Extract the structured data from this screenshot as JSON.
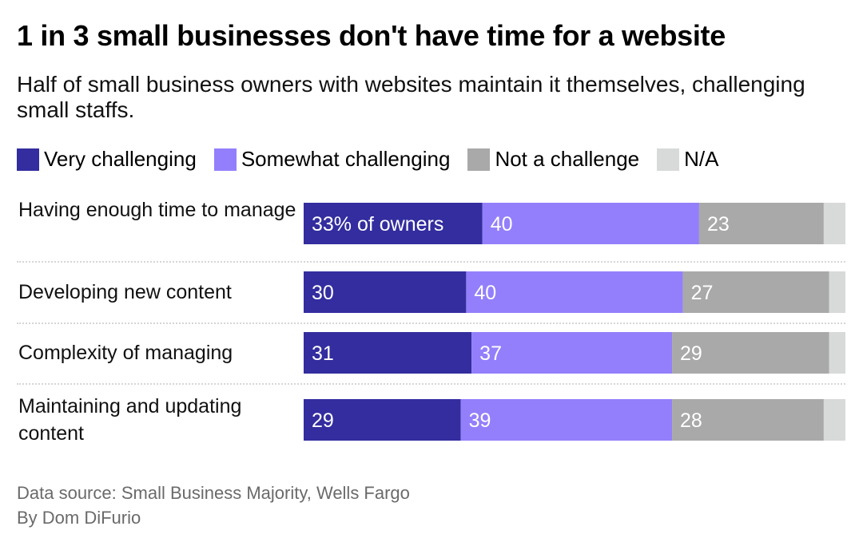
{
  "title": "1 in 3 small businesses don't have time for a website",
  "subtitle": "Half of small business owners with websites maintain it themselves, challenging small staffs.",
  "footer": {
    "source": "Data source: Small Business Majority, Wells Fargo",
    "byline": "By Dom DiFurio"
  },
  "chart_data": {
    "type": "bar",
    "orientation": "horizontal",
    "stacked": true,
    "title": "1 in 3 small businesses don't have time for a website",
    "subtitle": "Half of small business owners with websites maintain it themselves, challenging small staffs.",
    "xlabel": "",
    "ylabel": "",
    "xlim": [
      0,
      100
    ],
    "grid": false,
    "legend_position": "top-left",
    "categories": [
      "Having enough time to manage",
      "Developing new content",
      "Complexity of managing",
      "Maintaining and updating content"
    ],
    "series": [
      {
        "name": "Very challenging",
        "color": "#332d9f",
        "values": [
          33,
          30,
          31,
          29
        ],
        "labels": [
          "33% of owners",
          "30",
          "31",
          "29"
        ]
      },
      {
        "name": "Somewhat challenging",
        "color": "#937ffb",
        "values": [
          40,
          40,
          37,
          39
        ],
        "labels": [
          "40",
          "40",
          "37",
          "39"
        ]
      },
      {
        "name": "Not a challenge",
        "color": "#a9a9a9",
        "values": [
          23,
          27,
          29,
          28
        ],
        "labels": [
          "23",
          "27",
          "29",
          "28"
        ]
      },
      {
        "name": "N/A",
        "color": "#d8d9d9",
        "values": [
          4,
          3,
          3,
          4
        ],
        "labels": [
          "",
          "",
          "",
          ""
        ]
      }
    ]
  }
}
